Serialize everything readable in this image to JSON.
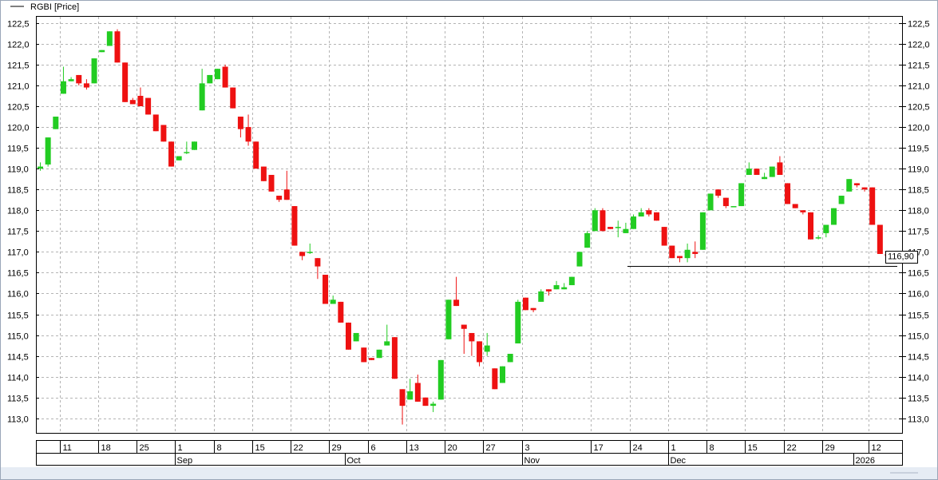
{
  "legend": {
    "label": "RGBI [Price]"
  },
  "price_label": "116,90",
  "colors": {
    "up": "#22cc22",
    "down": "#ee1111",
    "grid": "#b4b4b4",
    "line": "#000000",
    "status_bar": "#e6ecf4"
  },
  "chart_data": {
    "type": "candlestick",
    "series_name": "RGBI [Price]",
    "ylim": [
      112.65,
      122.65
    ],
    "y_ticks": [
      "113,0",
      "113,5",
      "114,0",
      "114,5",
      "115,0",
      "115,5",
      "116,0",
      "116,5",
      "117,0",
      "117,5",
      "118,0",
      "118,5",
      "119,0",
      "119,5",
      "120,0",
      "120,5",
      "121,0",
      "121,5",
      "122,0",
      "122,5"
    ],
    "y_tick_values": [
      113.0,
      113.5,
      114.0,
      114.5,
      115.0,
      115.5,
      116.0,
      116.5,
      117.0,
      117.5,
      118.0,
      118.5,
      119.0,
      119.5,
      120.0,
      120.5,
      121.0,
      121.5,
      122.0,
      122.5
    ],
    "grid": true,
    "last_price": 116.9,
    "support_level": 116.66,
    "day_labels": [
      {
        "label": "11",
        "index": 3
      },
      {
        "label": "18",
        "index": 8
      },
      {
        "label": "25",
        "index": 13
      },
      {
        "label": "1",
        "index": 18
      },
      {
        "label": "8",
        "index": 23
      },
      {
        "label": "15",
        "index": 28
      },
      {
        "label": "22",
        "index": 33
      },
      {
        "label": "29",
        "index": 38
      },
      {
        "label": "6",
        "index": 43
      },
      {
        "label": "13",
        "index": 48
      },
      {
        "label": "20",
        "index": 53
      },
      {
        "label": "27",
        "index": 58
      },
      {
        "label": "3",
        "index": 63
      },
      {
        "label": "17",
        "index": 72
      },
      {
        "label": "24",
        "index": 77
      },
      {
        "label": "1",
        "index": 82
      },
      {
        "label": "8",
        "index": 87
      },
      {
        "label": "15",
        "index": 92
      },
      {
        "label": "22",
        "index": 97
      },
      {
        "label": "29",
        "index": 102
      },
      {
        "label": "12",
        "index": 108
      }
    ],
    "month_labels": [
      {
        "label": "Sep",
        "index": 18
      },
      {
        "label": "Oct",
        "index": 40
      },
      {
        "label": "Nov",
        "index": 63
      },
      {
        "label": "Dec",
        "index": 82
      },
      {
        "label": "2026",
        "index": 106
      }
    ],
    "candles": [
      {
        "o": 119.0,
        "h": 119.15,
        "l": 118.95,
        "c": 119.05
      },
      {
        "o": 119.1,
        "h": 119.75,
        "l": 119.05,
        "c": 119.75
      },
      {
        "o": 119.95,
        "h": 120.25,
        "l": 119.95,
        "c": 120.25
      },
      {
        "o": 120.8,
        "h": 121.45,
        "l": 120.8,
        "c": 121.1
      },
      {
        "o": 121.1,
        "h": 121.2,
        "l": 121.1,
        "c": 121.15
      },
      {
        "o": 121.25,
        "h": 121.25,
        "l": 121.0,
        "c": 121.05
      },
      {
        "o": 121.05,
        "h": 121.15,
        "l": 120.9,
        "c": 120.95
      },
      {
        "o": 121.05,
        "h": 121.65,
        "l": 121.05,
        "c": 121.65
      },
      {
        "o": 121.8,
        "h": 121.85,
        "l": 121.8,
        "c": 121.85
      },
      {
        "o": 121.95,
        "h": 122.3,
        "l": 121.95,
        "c": 122.3
      },
      {
        "o": 122.3,
        "h": 122.35,
        "l": 121.55,
        "c": 121.55
      },
      {
        "o": 121.55,
        "h": 121.55,
        "l": 120.6,
        "c": 120.6
      },
      {
        "o": 120.65,
        "h": 120.7,
        "l": 120.55,
        "c": 120.55
      },
      {
        "o": 120.75,
        "h": 120.95,
        "l": 120.5,
        "c": 120.5
      },
      {
        "o": 120.7,
        "h": 120.7,
        "l": 120.3,
        "c": 120.3
      },
      {
        "o": 120.3,
        "h": 120.3,
        "l": 119.9,
        "c": 119.9
      },
      {
        "o": 120.05,
        "h": 120.05,
        "l": 119.65,
        "c": 119.65
      },
      {
        "o": 119.65,
        "h": 119.65,
        "l": 119.05,
        "c": 119.05
      },
      {
        "o": 119.2,
        "h": 119.3,
        "l": 119.2,
        "c": 119.3
      },
      {
        "o": 119.4,
        "h": 119.65,
        "l": 119.35,
        "c": 119.4
      },
      {
        "o": 119.45,
        "h": 119.65,
        "l": 119.45,
        "c": 119.65
      },
      {
        "o": 120.4,
        "h": 121.4,
        "l": 120.4,
        "c": 121.05
      },
      {
        "o": 121.05,
        "h": 121.25,
        "l": 121.05,
        "c": 121.25
      },
      {
        "o": 121.15,
        "h": 121.4,
        "l": 121.15,
        "c": 121.4
      },
      {
        "o": 121.45,
        "h": 121.5,
        "l": 120.95,
        "c": 120.95
      },
      {
        "o": 120.95,
        "h": 120.95,
        "l": 120.45,
        "c": 120.45
      },
      {
        "o": 120.25,
        "h": 120.25,
        "l": 119.75,
        "c": 119.95
      },
      {
        "o": 120.0,
        "h": 120.3,
        "l": 119.55,
        "c": 119.65
      },
      {
        "o": 119.65,
        "h": 119.65,
        "l": 119.0,
        "c": 119.0
      },
      {
        "o": 119.05,
        "h": 119.05,
        "l": 118.7,
        "c": 118.7
      },
      {
        "o": 118.85,
        "h": 118.85,
        "l": 118.45,
        "c": 118.45
      },
      {
        "o": 118.35,
        "h": 118.35,
        "l": 118.2,
        "c": 118.25
      },
      {
        "o": 118.5,
        "h": 118.95,
        "l": 118.25,
        "c": 118.25
      },
      {
        "o": 118.1,
        "h": 118.1,
        "l": 117.15,
        "c": 117.15
      },
      {
        "o": 117.0,
        "h": 117.0,
        "l": 116.8,
        "c": 116.9
      },
      {
        "o": 117.0,
        "h": 117.2,
        "l": 116.95,
        "c": 117.0
      },
      {
        "o": 116.85,
        "h": 116.85,
        "l": 116.35,
        "c": 116.65
      },
      {
        "o": 116.45,
        "h": 116.45,
        "l": 115.75,
        "c": 115.75
      },
      {
        "o": 115.75,
        "h": 115.95,
        "l": 115.75,
        "c": 115.85
      },
      {
        "o": 115.8,
        "h": 115.8,
        "l": 115.3,
        "c": 115.3
      },
      {
        "o": 115.3,
        "h": 115.3,
        "l": 114.65,
        "c": 114.65
      },
      {
        "o": 114.85,
        "h": 115.05,
        "l": 114.85,
        "c": 115.05
      },
      {
        "o": 114.7,
        "h": 114.7,
        "l": 114.35,
        "c": 114.35
      },
      {
        "o": 114.45,
        "h": 114.45,
        "l": 114.4,
        "c": 114.4
      },
      {
        "o": 114.45,
        "h": 114.65,
        "l": 114.45,
        "c": 114.65
      },
      {
        "o": 114.75,
        "h": 115.25,
        "l": 114.75,
        "c": 114.85
      },
      {
        "o": 114.95,
        "h": 114.95,
        "l": 113.95,
        "c": 113.95
      },
      {
        "o": 113.7,
        "h": 113.7,
        "l": 112.85,
        "c": 113.3
      },
      {
        "o": 113.45,
        "h": 113.95,
        "l": 113.45,
        "c": 113.65
      },
      {
        "o": 113.85,
        "h": 114.05,
        "l": 113.4,
        "c": 113.4
      },
      {
        "o": 113.5,
        "h": 113.5,
        "l": 113.3,
        "c": 113.3
      },
      {
        "o": 113.3,
        "h": 113.4,
        "l": 113.15,
        "c": 113.35
      },
      {
        "o": 113.45,
        "h": 114.4,
        "l": 113.45,
        "c": 114.4
      },
      {
        "o": 114.9,
        "h": 115.85,
        "l": 114.9,
        "c": 115.85
      },
      {
        "o": 115.85,
        "h": 116.4,
        "l": 115.7,
        "c": 115.7
      },
      {
        "o": 115.25,
        "h": 115.25,
        "l": 114.55,
        "c": 115.15
      },
      {
        "o": 115.05,
        "h": 115.05,
        "l": 114.5,
        "c": 114.85
      },
      {
        "o": 114.85,
        "h": 114.85,
        "l": 114.25,
        "c": 114.35
      },
      {
        "o": 114.6,
        "h": 115.05,
        "l": 114.5,
        "c": 114.75
      },
      {
        "o": 114.2,
        "h": 114.2,
        "l": 113.7,
        "c": 113.7
      },
      {
        "o": 113.85,
        "h": 114.25,
        "l": 113.85,
        "c": 114.25
      },
      {
        "o": 114.35,
        "h": 114.55,
        "l": 114.35,
        "c": 114.55
      },
      {
        "o": 114.8,
        "h": 115.85,
        "l": 114.8,
        "c": 115.8
      },
      {
        "o": 115.9,
        "h": 115.9,
        "l": 115.6,
        "c": 115.6
      },
      {
        "o": 115.65,
        "h": 115.65,
        "l": 115.55,
        "c": 115.6
      },
      {
        "o": 115.8,
        "h": 116.1,
        "l": 115.8,
        "c": 116.05
      },
      {
        "o": 116.1,
        "h": 116.1,
        "l": 115.95,
        "c": 116.05
      },
      {
        "o": 116.1,
        "h": 116.3,
        "l": 116.1,
        "c": 116.2
      },
      {
        "o": 116.1,
        "h": 116.25,
        "l": 116.1,
        "c": 116.15
      },
      {
        "o": 116.2,
        "h": 116.4,
        "l": 116.2,
        "c": 116.4
      },
      {
        "o": 116.65,
        "h": 117.0,
        "l": 116.65,
        "c": 117.0
      },
      {
        "o": 117.1,
        "h": 117.5,
        "l": 117.1,
        "c": 117.45
      },
      {
        "o": 117.5,
        "h": 118.05,
        "l": 117.5,
        "c": 118.0
      },
      {
        "o": 118.0,
        "h": 118.05,
        "l": 117.5,
        "c": 117.5
      },
      {
        "o": 117.6,
        "h": 117.6,
        "l": 117.55,
        "c": 117.55
      },
      {
        "o": 117.6,
        "h": 117.75,
        "l": 117.35,
        "c": 117.6
      },
      {
        "o": 117.45,
        "h": 117.7,
        "l": 117.45,
        "c": 117.55
      },
      {
        "o": 117.55,
        "h": 117.9,
        "l": 117.55,
        "c": 117.85
      },
      {
        "o": 117.85,
        "h": 118.05,
        "l": 117.85,
        "c": 117.95
      },
      {
        "o": 118.0,
        "h": 118.05,
        "l": 117.85,
        "c": 117.9
      },
      {
        "o": 117.95,
        "h": 117.95,
        "l": 117.75,
        "c": 117.75
      },
      {
        "o": 117.6,
        "h": 117.6,
        "l": 117.15,
        "c": 117.15
      },
      {
        "o": 117.15,
        "h": 117.15,
        "l": 116.85,
        "c": 116.85
      },
      {
        "o": 116.9,
        "h": 116.9,
        "l": 116.75,
        "c": 116.85
      },
      {
        "o": 116.85,
        "h": 117.2,
        "l": 116.75,
        "c": 117.05
      },
      {
        "o": 117.0,
        "h": 117.25,
        "l": 116.85,
        "c": 116.95
      },
      {
        "o": 117.05,
        "h": 117.95,
        "l": 117.05,
        "c": 117.95
      },
      {
        "o": 118.0,
        "h": 118.4,
        "l": 118.0,
        "c": 118.4
      },
      {
        "o": 118.5,
        "h": 118.5,
        "l": 118.3,
        "c": 118.35
      },
      {
        "o": 118.3,
        "h": 118.3,
        "l": 118.05,
        "c": 118.1
      },
      {
        "o": 118.1,
        "h": 118.1,
        "l": 118.1,
        "c": 118.1
      },
      {
        "o": 118.1,
        "h": 118.65,
        "l": 118.1,
        "c": 118.65
      },
      {
        "o": 118.85,
        "h": 119.15,
        "l": 118.85,
        "c": 119.0
      },
      {
        "o": 119.0,
        "h": 119.0,
        "l": 118.85,
        "c": 118.85
      },
      {
        "o": 118.75,
        "h": 118.9,
        "l": 118.75,
        "c": 118.8
      },
      {
        "o": 118.8,
        "h": 119.05,
        "l": 118.8,
        "c": 119.05
      },
      {
        "o": 119.15,
        "h": 119.3,
        "l": 118.85,
        "c": 118.85
      },
      {
        "o": 118.65,
        "h": 118.65,
        "l": 118.15,
        "c": 118.15
      },
      {
        "o": 118.15,
        "h": 118.15,
        "l": 118.05,
        "c": 118.05
      },
      {
        "o": 118.0,
        "h": 118.0,
        "l": 117.9,
        "c": 117.95
      },
      {
        "o": 117.95,
        "h": 117.95,
        "l": 117.3,
        "c": 117.3
      },
      {
        "o": 117.35,
        "h": 117.4,
        "l": 117.3,
        "c": 117.35
      },
      {
        "o": 117.45,
        "h": 117.65,
        "l": 117.35,
        "c": 117.65
      },
      {
        "o": 117.65,
        "h": 118.05,
        "l": 117.65,
        "c": 118.05
      },
      {
        "o": 118.15,
        "h": 118.35,
        "l": 118.15,
        "c": 118.35
      },
      {
        "o": 118.45,
        "h": 118.75,
        "l": 118.45,
        "c": 118.75
      },
      {
        "o": 118.65,
        "h": 118.65,
        "l": 118.55,
        "c": 118.6
      },
      {
        "o": 118.55,
        "h": 118.55,
        "l": 118.45,
        "c": 118.5
      },
      {
        "o": 118.55,
        "h": 118.55,
        "l": 117.65,
        "c": 117.65
      },
      {
        "o": 117.65,
        "h": 117.65,
        "l": 116.95,
        "c": 116.95
      },
      {
        "o": 116.95,
        "h": 116.95,
        "l": 116.9,
        "c": 116.9
      }
    ]
  }
}
